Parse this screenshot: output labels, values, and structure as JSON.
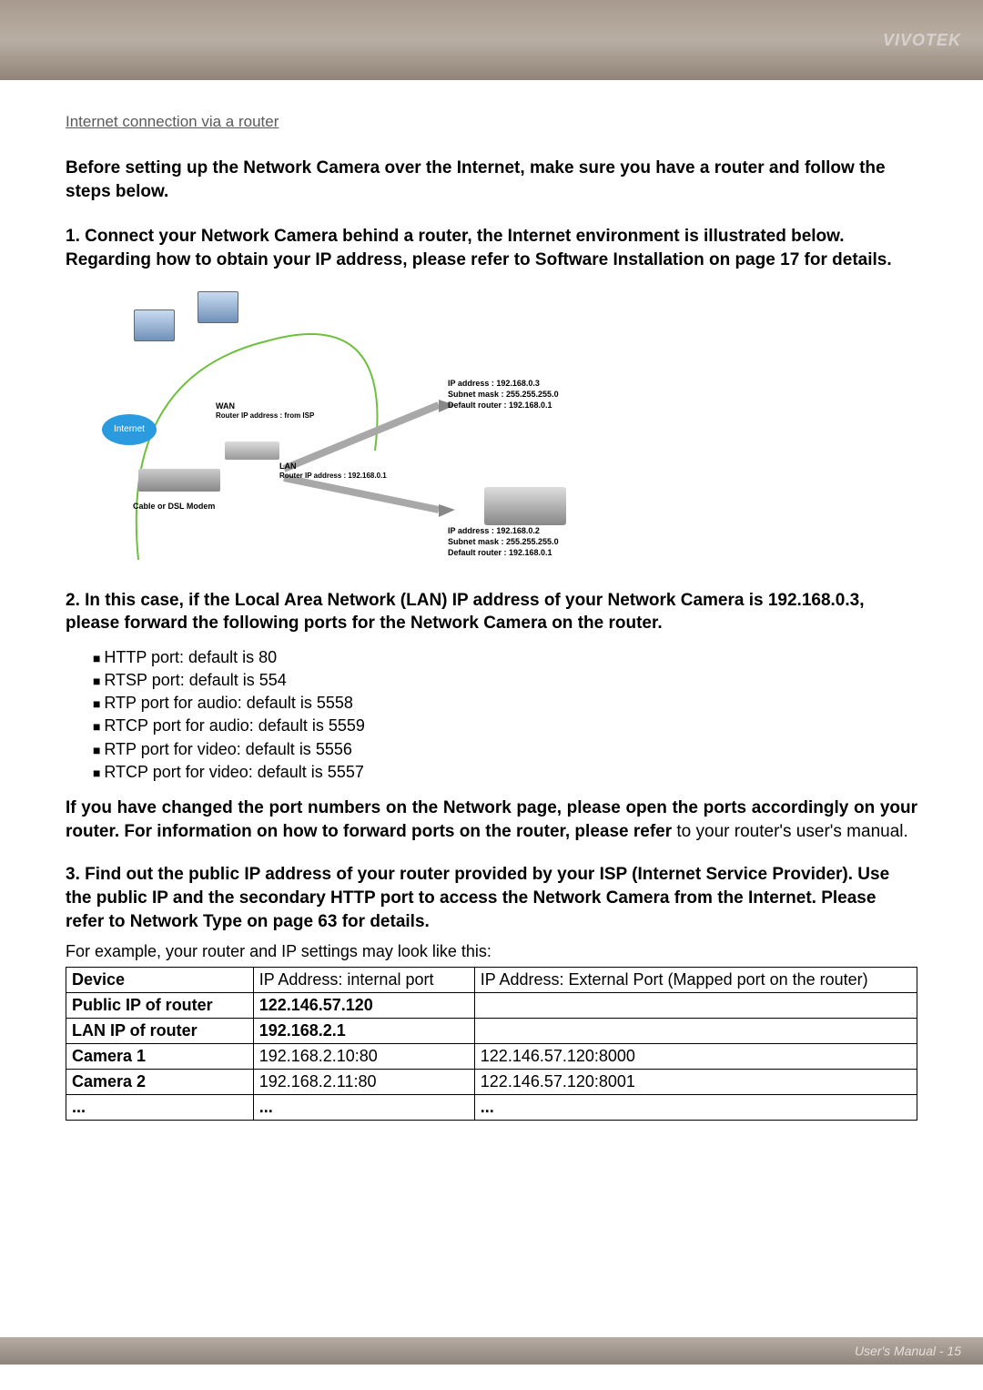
{
  "header": {
    "brand": "VIVOTEK"
  },
  "section_title": "Internet connection via a router",
  "intro": "Before setting up the Network Camera over the Internet, make sure you have a router and follow the steps below.",
  "step1": "1. Connect your Network Camera behind a router, the Internet environment is illustrated below. Regarding how to obtain your IP address, please refer to Software Installation on page 17 for details.",
  "diagram": {
    "internet": "Internet",
    "modem": "Cable or DSL Modem",
    "wan_label": "WAN",
    "wan_ip": "Router IP address : from ISP",
    "lan_label": "LAN",
    "lan_ip": "Router IP address : 192.168.0.1",
    "camera": {
      "ip": "IP address : 192.168.0.3",
      "mask": "Subnet mask : 255.255.255.0",
      "gw": "Default router : 192.168.0.1"
    },
    "laptop": {
      "ip": "IP address : 192.168.0.2",
      "mask": "Subnet mask : 255.255.255.0",
      "gw": "Default router : 192.168.0.1"
    }
  },
  "step2": "2. In this case, if the Local Area Network (LAN) IP address of your Network Camera is 192.168.0.3, please forward the following ports for the Network Camera on the router.",
  "ports": [
    "HTTP port: default is 80",
    "RTSP port: default is 554",
    "RTP port for audio: default is 5558",
    "RTCP port for audio: default is 5559",
    "RTP port for video: default is 5556",
    "RTCP port for video: default is 5557"
  ],
  "note_bold1": "If you have changed the port numbers on the Network page, please open the ports accordingly on your router. For information on how to forward ports on the router, please refer",
  "note_plain": " to your router's user's manual.",
  "step3": "3. Find out the public IP address of your router provided by your ISP (Internet Service Provider). Use the public IP and the secondary HTTP port to access the Network Camera from the Internet. Please refer to Network Type on page 63 for details.",
  "table_caption": "For example, your router and IP settings may look like this:",
  "table": {
    "hdr": {
      "device": "Device",
      "internal": "IP Address: internal port",
      "external": "IP Address: External Port (Mapped port on the router)"
    },
    "rows": [
      {
        "c1": "Public IP of router",
        "c2": "122.146.57.120",
        "c3": "",
        "bold_c1": true,
        "bold_c2": true
      },
      {
        "c1": "LAN IP of router",
        "c2": "192.168.2.1",
        "c3": "",
        "bold_c1": true,
        "bold_c2": true
      },
      {
        "c1": "Camera 1",
        "c2": "192.168.2.10:80",
        "c3": "122.146.57.120:8000",
        "bold_c1": true,
        "bold_c2": false
      },
      {
        "c1": "Camera 2",
        "c2": "192.168.2.11:80",
        "c3": "122.146.57.120:8001",
        "bold_c1": true,
        "bold_c2": false
      },
      {
        "c1": "...",
        "c2": "...",
        "c3": "...",
        "bold_c1": true,
        "bold_c2": true
      }
    ]
  },
  "footer": "User's Manual - 15"
}
